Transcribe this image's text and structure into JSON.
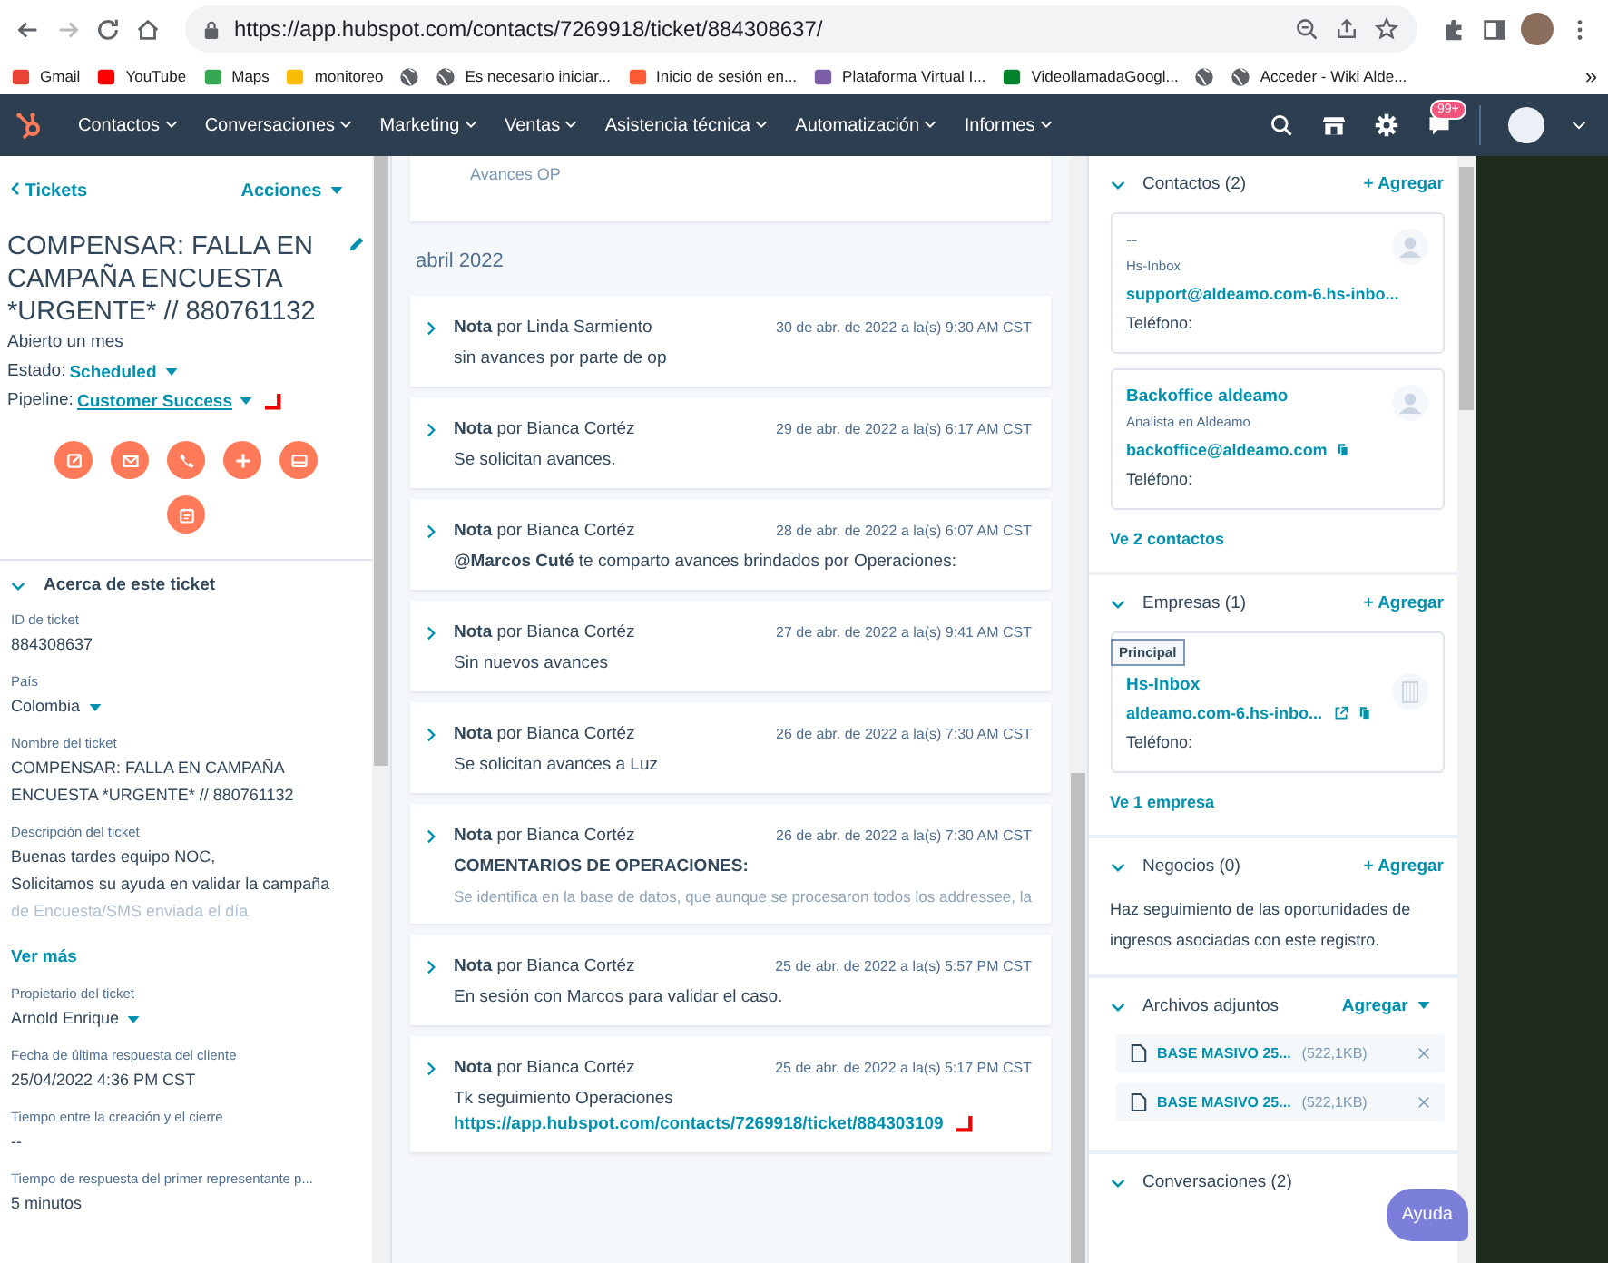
{
  "browser": {
    "url": "https://app.hubspot.com/contacts/7269918/ticket/884308637/",
    "bookmarks": [
      {
        "kind": "gmail",
        "label": "Gmail"
      },
      {
        "kind": "youtube",
        "label": "YouTube"
      },
      {
        "kind": "maps",
        "label": "Maps"
      },
      {
        "kind": "drive",
        "label": "monitoreo"
      },
      {
        "kind": "globe"
      },
      {
        "kind": "globe",
        "label": "Es necesario iniciar..."
      },
      {
        "kind": "hubspot",
        "label": "Inicio de sesión en..."
      },
      {
        "kind": "image",
        "label": "Plataforma Virtual I..."
      },
      {
        "kind": "meet",
        "label": "VideollamadaGoogl..."
      },
      {
        "kind": "globe"
      },
      {
        "kind": "globe",
        "label": "Acceder - Wiki Alde..."
      }
    ],
    "more": "»"
  },
  "nav": {
    "items": [
      "Contactos",
      "Conversaciones",
      "Marketing",
      "Ventas",
      "Asistencia técnica",
      "Automatización",
      "Informes"
    ],
    "badge": "99+"
  },
  "ticket": {
    "back": "Tickets",
    "actions": "Acciones",
    "title": "COMPENSAR: FALLA EN CAMPAÑA ENCUESTA *URGENTE* // 880761132",
    "opened": "Abierto un mes",
    "status_label": "Estado:",
    "status": "Scheduled",
    "pipeline_label": "Pipeline:",
    "pipeline": "Customer Success",
    "about": {
      "title": "Acerca de este ticket",
      "expanded": true,
      "fields": [
        {
          "kind": "text",
          "label": "ID de ticket",
          "value": "884308637"
        },
        {
          "kind": "dropdown",
          "label": "País",
          "value": "Colombia"
        },
        {
          "kind": "text",
          "label": "Nombre del ticket",
          "value": "COMPENSAR: FALLA EN CAMPAÑA ENCUESTA *URGENTE* // 880761132"
        },
        {
          "kind": "text",
          "label": "Descripción del ticket",
          "value": "Buenas tardes equipo NOC,\nSolicitamos su ayuda en validar la campaña",
          "faded": "de Encuesta/SMS enviada el día"
        },
        {
          "kind": "more",
          "label": "Ver más"
        },
        {
          "kind": "dropdown",
          "label": "Propietario del ticket",
          "value": "Arnold Enrique"
        },
        {
          "kind": "text",
          "label": "Fecha de última respuesta del cliente",
          "value": "25/04/2022 4:36 PM CST"
        },
        {
          "kind": "text",
          "label": "Tiempo entre la creación y el cierre",
          "value": "--"
        },
        {
          "kind": "text",
          "label": "Tiempo de respuesta del primer representante p...",
          "value": "5 minutos"
        }
      ]
    }
  },
  "timeline": {
    "top_card": "Avances OP",
    "month": "abril 2022",
    "notes": [
      {
        "title": "**Nota** por Linda Sarmiento",
        "date": "30 de abr. de 2022 a la(s) 9:30 AM CST",
        "expanded": false,
        "body": "sin avances por parte de op"
      },
      {
        "title": "**Nota** por Bianca Cortéz",
        "date": "29 de abr. de 2022 a la(s) 6:17 AM CST",
        "expanded": false,
        "body": "Se solicitan avances."
      },
      {
        "title": "**Nota** por Bianca Cortéz",
        "date": "28 de abr. de 2022 a la(s) 6:07 AM CST",
        "expanded": false,
        "body": "**@Marcos Cuté** te comparto avances brindados por Operaciones:"
      },
      {
        "title": "**Nota** por Bianca Cortéz",
        "date": "27 de abr. de 2022 a la(s) 9:41 AM CST",
        "expanded": false,
        "body": "Sin nuevos avances"
      },
      {
        "title": "**Nota** por Bianca Cortéz",
        "date": "26 de abr. de 2022 a la(s) 7:30 AM CST",
        "expanded": false,
        "body": "Se solicitan avances a Luz"
      },
      {
        "title": "**Nota** por Bianca Cortéz",
        "date": "26 de abr. de 2022 a la(s) 7:30 AM CST",
        "expanded": false,
        "body": "**COMENTARIOS DE OPERACIONES:**",
        "faded": "Se identifica en la base de datos, que aunque se procesaron todos los addressee, la"
      },
      {
        "title": "**Nota** por Bianca Cortéz",
        "date": "25 de abr. de 2022 a la(s) 5:57 PM CST",
        "expanded": false,
        "body": "En sesión con Marcos para validar el caso."
      },
      {
        "title": "**Nota** por Bianca Cortéz",
        "date": "25 de abr. de 2022 a la(s) 5:17 PM CST",
        "expanded": false,
        "body": "Tk seguimiento Operaciones",
        "link": "https://app.hubspot.com/contacts/7269918/ticket/884303109"
      }
    ]
  },
  "sidebar": {
    "contacts": {
      "title": "Contactos (2)",
      "expanded": true,
      "add": "+ Agregar",
      "cards": [
        {
          "name": "--",
          "subtitle": "Hs-Inbox",
          "email": "support@aldeamo.com-6.hs-inbo...",
          "phone": "Teléfono:"
        },
        {
          "name": "Backoffice aldeamo",
          "subtitle": "Analista en Aldeamo",
          "email": "backoffice@aldeamo.com",
          "phone": "Teléfono:"
        }
      ],
      "footer": "Ve 2 contactos"
    },
    "companies": {
      "title": "Empresas (1)",
      "expanded": true,
      "add": "+ Agregar",
      "cards": [
        {
          "tag": "Principal",
          "name": "Hs-Inbox",
          "domain": "aldeamo.com-6.hs-inbo...",
          "phone": "Teléfono:"
        }
      ],
      "footer": "Ve 1 empresa"
    },
    "deals": {
      "title": "Negocios (0)",
      "expanded": true,
      "add": "+ Agregar",
      "text": "Haz seguimiento de las oportunidades de ingresos asociadas con este registro."
    },
    "attachments": {
      "title": "Archivos adjuntos",
      "expanded": true,
      "add": "Agregar",
      "files": [
        {
          "name": "BASE MASIVO 25...",
          "size": "(522,1KB)"
        },
        {
          "name": "BASE MASIVO 25...",
          "size": "(522,1KB)"
        }
      ]
    },
    "conversations": {
      "title": "Conversaciones (2)",
      "expanded": true
    }
  },
  "help": "Ayuda"
}
